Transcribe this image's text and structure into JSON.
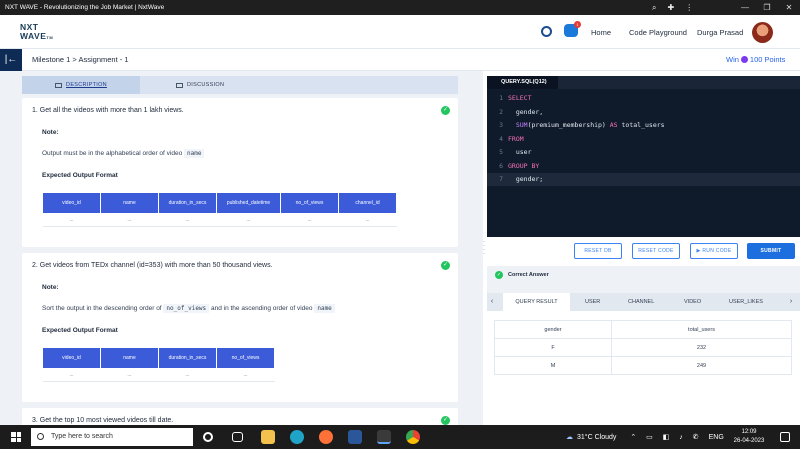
{
  "browser": {
    "title": "NXT WAVE - Revolutionizing the Job Market | NxtWave"
  },
  "header": {
    "logo_line1": "NXT",
    "logo_line2": "WAVE",
    "logo_tm": "TM",
    "chat_badge": "1",
    "nav_home": "Home",
    "nav_playground": "Code Playground",
    "user_name": "Durga Prasad"
  },
  "breadcrumb": {
    "toggle_icon": "|←",
    "path": "Milestone 1 > Assignment - 1",
    "win_prefix": "Win",
    "win_points": "100 Points"
  },
  "tabs": {
    "description": "DESCRIPTION",
    "discussion": "DISCUSSION"
  },
  "questions": [
    {
      "title": "1.  Get all the videos with more than 1 lakh views.",
      "note": "Note:",
      "text": "Output must be in the alphabetical order of video",
      "code1": "name",
      "eof": "Expected Output Format",
      "columns": [
        "video_id",
        "name",
        "duration_in_secs",
        "published_datetime",
        "no_of_views",
        "channel_id"
      ],
      "row": [
        "...",
        "...",
        "...",
        "...",
        "...",
        "..."
      ]
    },
    {
      "title": "2.  Get videos from TEDx channel (id=353) with more than 50 thousand views.",
      "note": "Note:",
      "text_a": "Sort the output in the descending order of",
      "code1": "no_of_views",
      "text_b": "and in the ascending order of video",
      "code2": "name",
      "eof": "Expected Output Format",
      "columns": [
        "video_id",
        "name",
        "duration_in_secs",
        "no_of_views"
      ],
      "row": [
        "...",
        "...",
        "...",
        "..."
      ]
    },
    {
      "title": "3.  Get the top 10 most viewed videos till date."
    }
  ],
  "editor": {
    "tab": "QUERY.SQL(Q12)",
    "lines": [
      {
        "n": "1",
        "parts": [
          {
            "t": "SELECT",
            "c": "kw"
          }
        ]
      },
      {
        "n": "2",
        "parts": [
          {
            "t": "  gender,",
            "c": "id"
          }
        ]
      },
      {
        "n": "3",
        "parts": [
          {
            "t": "  SUM",
            "c": "fn"
          },
          {
            "t": "(premium_membership) ",
            "c": "id"
          },
          {
            "t": "AS",
            "c": "kw"
          },
          {
            "t": " total_users",
            "c": "id"
          }
        ]
      },
      {
        "n": "4",
        "parts": [
          {
            "t": "FROM",
            "c": "kw"
          }
        ]
      },
      {
        "n": "5",
        "parts": [
          {
            "t": "  user",
            "c": "id"
          }
        ]
      },
      {
        "n": "6",
        "parts": [
          {
            "t": "GROUP BY",
            "c": "kw"
          }
        ]
      },
      {
        "n": "7",
        "parts": [
          {
            "t": "  gender;",
            "c": "id"
          }
        ]
      }
    ]
  },
  "actions": {
    "reset_db": "RESET DB",
    "reset_code": "RESET CODE",
    "run_code": "▶ RUN CODE",
    "submit": "SUBMIT"
  },
  "result": {
    "status": "Correct Answer",
    "tabs": [
      "QUERY RESULT",
      "USER",
      "CHANNEL",
      "VIDEO",
      "USER_LIKES"
    ],
    "columns": [
      "gender",
      "total_users"
    ],
    "rows": [
      [
        "F",
        "232"
      ],
      [
        "M",
        "249"
      ]
    ]
  },
  "taskbar": {
    "search_placeholder": "Type here to search",
    "weather": "31°C  Cloudy",
    "lang": "ENG",
    "time": "12:09",
    "date": "26-04-2023"
  },
  "colors": {
    "accent": "#3b5bd9",
    "navy": "#0d2b55",
    "success": "#22c55e",
    "editor_bg": "#0f1a2b"
  }
}
